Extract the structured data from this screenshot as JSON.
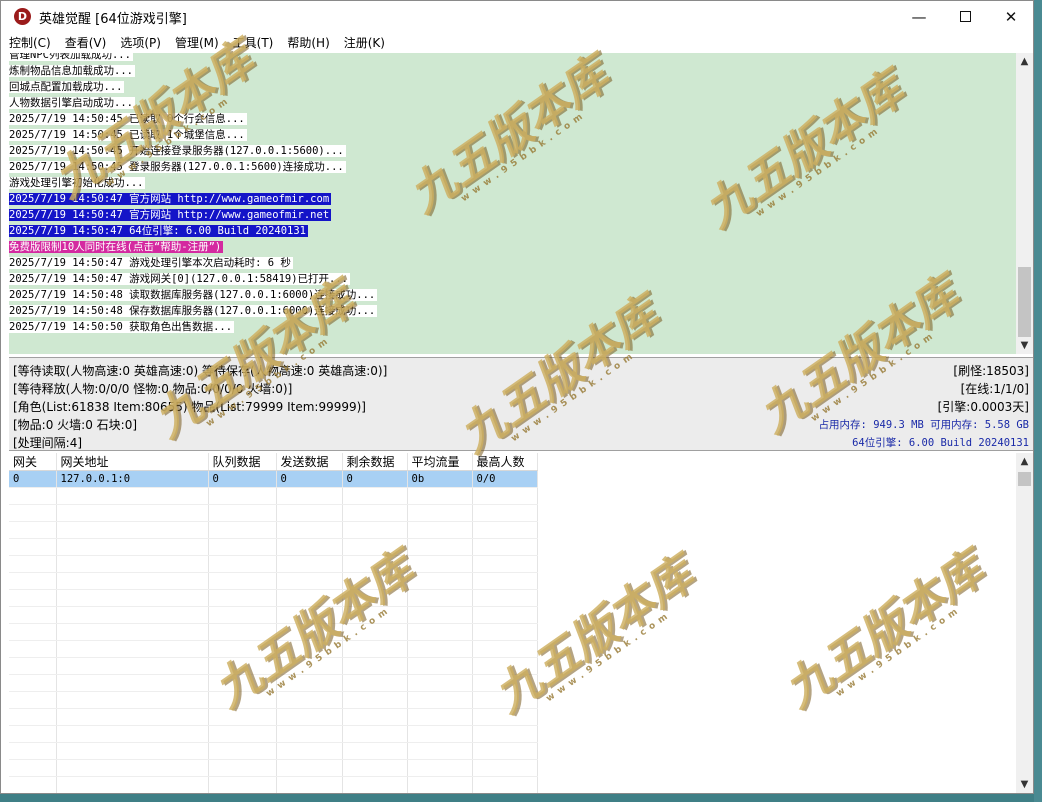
{
  "window": {
    "app_icon_letter": "D",
    "title": "英雄觉醒 [64位游戏引擎]",
    "min_symbol": "—",
    "close_symbol": "✕"
  },
  "menu": [
    "控制(C)",
    "查看(V)",
    "选项(P)",
    "管理(M)",
    "工具(T)",
    "帮助(H)",
    "注册(K)"
  ],
  "log": [
    {
      "text": "管理NPC列表加载成功...",
      "style": "normal"
    },
    {
      "text": "炼制物品信息加载成功...",
      "style": "normal"
    },
    {
      "text": "回城点配置加载成功...",
      "style": "normal"
    },
    {
      "text": "人物数据引擎启动成功...",
      "style": "normal"
    },
    {
      "text": "2025/7/19 14:50:45 已读取 0个行会信息...",
      "style": "normal"
    },
    {
      "text": "2025/7/19 14:50:45 已读取 1个城堡信息...",
      "style": "normal"
    },
    {
      "text": "2025/7/19 14:50:45 开始连接登录服务器(127.0.0.1:5600)...",
      "style": "normal"
    },
    {
      "text": "2025/7/19 14:50:45 登录服务器(127.0.0.1:5600)连接成功...",
      "style": "normal"
    },
    {
      "text": "游戏处理引擎初始化成功...",
      "style": "normal"
    },
    {
      "text": "2025/7/19 14:50:47 官方网站 http://www.gameofmir.com",
      "style": "blue"
    },
    {
      "text": "2025/7/19 14:50:47 官方网站 http://www.gameofmir.net",
      "style": "blue"
    },
    {
      "text": "2025/7/19 14:50:47 64位引擎: 6.00 Build 20240131",
      "style": "blue"
    },
    {
      "text": "免费版限制10人同时在线(点击“帮助-注册”)",
      "style": "pink"
    },
    {
      "text": "2025/7/19 14:50:47 游戏处理引擎本次启动耗时: 6 秒",
      "style": "normal"
    },
    {
      "text": "2025/7/19 14:50:47 游戏网关[0](127.0.0.1:58419)已打开...",
      "style": "normal"
    },
    {
      "text": "2025/7/19 14:50:48 读取数据库服务器(127.0.0.1:6000)连接成功...",
      "style": "normal"
    },
    {
      "text": "2025/7/19 14:50:48 保存数据库服务器(127.0.0.1:6000)连接成功...",
      "style": "normal"
    },
    {
      "text": "2025/7/19 14:50:50 获取角色出售数据...",
      "style": "normal"
    }
  ],
  "status": {
    "wait_read": "[等待读取(人物高速:0 英雄高速:0) 等待保存(人物高速:0 英雄高速:0)]",
    "wait_release": "[等待释放(人物:0/0/0 怪物:0 物品:0/0/0/0 火墙:0)]",
    "role_items": "[角色(List:61838 Item:80655) 物品(List:79999 Item:99999)]",
    "items_fire": "[物品:0 火墙:0 石块:0]",
    "interval": "[处理间隔:4]",
    "refresh_monsters": "[刷怪:18503]",
    "online": "[在线:1/1/0]",
    "engine_time": "[引擎:0.0003天]",
    "memory": "占用内存: 949.3 MB 可用内存: 5.58 GB",
    "engine_build": "64位引擎: 6.00 Build 20240131"
  },
  "gateway_table": {
    "headers": [
      "网关",
      "网关地址",
      "队列数据",
      "发送数据",
      "剩余数据",
      "平均流量",
      "最高人数"
    ],
    "rows": [
      [
        "0",
        "127.0.0.1:0",
        "0",
        "0",
        "0",
        "0b",
        "0/0"
      ]
    ]
  },
  "watermark": {
    "main": "九五版本库",
    "url": "w w w . 9 5 b b k . c o m"
  },
  "colors": {
    "log_bg": "#cfe8d1",
    "highlight_blue": "#1414c8",
    "highlight_pink": "#d42aa0",
    "status_blue_text": "#1a2aa8",
    "selected_row": "#a8d0f4"
  }
}
